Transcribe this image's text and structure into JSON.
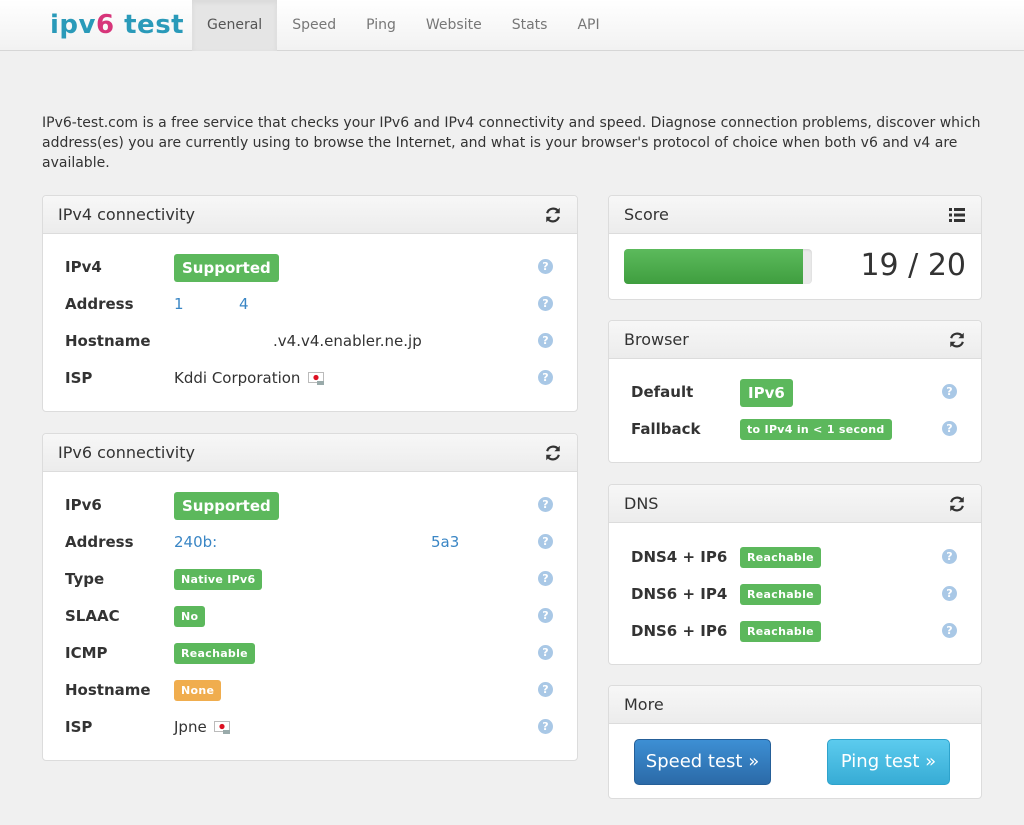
{
  "brand": {
    "part1": "ipv",
    "part2": "6",
    "part3": " test"
  },
  "nav": {
    "items": [
      "General",
      "Speed",
      "Ping",
      "Website",
      "Stats",
      "API"
    ]
  },
  "intro": "IPv6-test.com is a free service that checks your IPv6 and IPv4 connectivity and speed. Diagnose connection problems, discover which address(es) you are currently using to browse the Internet, and what is your browser's protocol of choice when both v6 and v4 are available.",
  "ipv4": {
    "title": "IPv4 connectivity",
    "rows": {
      "ipv4": {
        "label": "IPv4",
        "value": "Supported"
      },
      "address": {
        "label": "Address",
        "v1": "1",
        "v2": "4"
      },
      "hostname": {
        "label": "Hostname",
        "value": ".v4.v4.enabler.ne.jp"
      },
      "isp": {
        "label": "ISP",
        "value": "Kddi Corporation"
      }
    }
  },
  "ipv6": {
    "title": "IPv6 connectivity",
    "rows": {
      "ipv6": {
        "label": "IPv6",
        "value": "Supported"
      },
      "address": {
        "label": "Address",
        "v1": "240b:",
        "v2": "5a3"
      },
      "type": {
        "label": "Type",
        "value": "Native IPv6"
      },
      "slaac": {
        "label": "SLAAC",
        "value": "No"
      },
      "icmp": {
        "label": "ICMP",
        "value": "Reachable"
      },
      "hostname": {
        "label": "Hostname",
        "value": "None"
      },
      "isp": {
        "label": "ISP",
        "value": "Jpne"
      }
    }
  },
  "score": {
    "title": "Score",
    "text": "19 / 20",
    "fraction": 0.95
  },
  "browser": {
    "title": "Browser",
    "default": {
      "label": "Default",
      "value": "IPv6"
    },
    "fallback": {
      "label": "Fallback",
      "value": "to IPv4 in < 1 second"
    }
  },
  "dns": {
    "title": "DNS",
    "rows": [
      {
        "label": "DNS4 + IP6",
        "value": "Reachable"
      },
      {
        "label": "DNS6 + IP4",
        "value": "Reachable"
      },
      {
        "label": "DNS6 + IP6",
        "value": "Reachable"
      }
    ]
  },
  "more": {
    "title": "More",
    "speed_btn": "Speed test »",
    "ping_btn": "Ping test »"
  },
  "help_glyph": "?",
  "colors": {
    "success": "#5cb85c",
    "warning": "#f0ad4e",
    "link": "#3a86c5",
    "help": "#a9c8e6"
  }
}
